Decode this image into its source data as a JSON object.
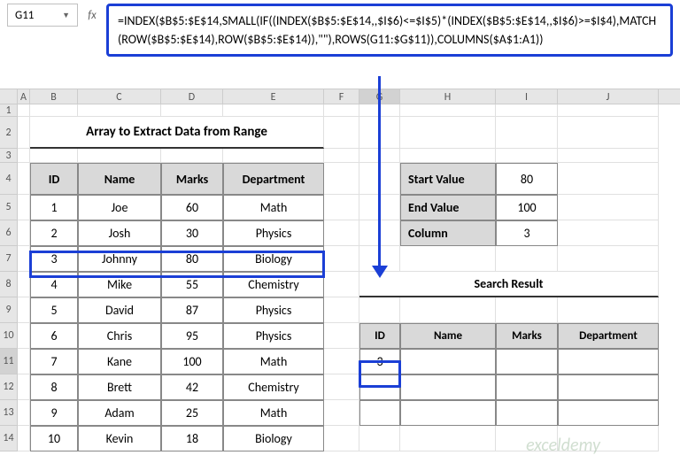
{
  "namebox": "G11",
  "formula": "=INDEX($B$5:$E$14,SMALL(IF((INDEX($B$5:$E$14,,$I$6)<=$I$5)*(INDEX($B$5:$E$14,,$I$6)>=$I$4),MATCH(ROW($B$5:$E$14),ROW($B$5:$E$14)),\"\"),ROWS(G11:$G$11)),COLUMNS($A$1:A1))",
  "cols": [
    "A",
    "B",
    "C",
    "D",
    "E",
    "F",
    "G",
    "H",
    "I",
    "J"
  ],
  "rows": [
    "1",
    "2",
    "3",
    "4",
    "5",
    "6",
    "7",
    "8",
    "9",
    "10",
    "11",
    "12",
    "13",
    "14"
  ],
  "title": "Array to Extract Data from Range",
  "headers": {
    "id": "ID",
    "name": "Name",
    "marks": "Marks",
    "dept": "Department"
  },
  "data": [
    {
      "id": "1",
      "name": "Joe",
      "marks": "60",
      "dept": "Math"
    },
    {
      "id": "2",
      "name": "Josh",
      "marks": "30",
      "dept": "Physics"
    },
    {
      "id": "3",
      "name": "Johnny",
      "marks": "80",
      "dept": "Biology"
    },
    {
      "id": "4",
      "name": "Mike",
      "marks": "55",
      "dept": "Chemistry"
    },
    {
      "id": "5",
      "name": "David",
      "marks": "87",
      "dept": "Physics"
    },
    {
      "id": "6",
      "name": "Chris",
      "marks": "95",
      "dept": "Physics"
    },
    {
      "id": "7",
      "name": "Kane",
      "marks": "100",
      "dept": "Math"
    },
    {
      "id": "8",
      "name": "Brett",
      "marks": "42",
      "dept": "Chemistry"
    },
    {
      "id": "9",
      "name": "Adam",
      "marks": "25",
      "dept": "Math"
    },
    {
      "id": "10",
      "name": "Kevin",
      "marks": "18",
      "dept": "Biology"
    }
  ],
  "params": {
    "start_label": "Start Value",
    "start_val": "80",
    "end_label": "End Value",
    "end_val": "100",
    "col_label": "Column",
    "col_val": "3"
  },
  "result_title": "Search Result",
  "result_headers": {
    "id": "ID",
    "name": "Name",
    "marks": "Marks",
    "dept": "Department"
  },
  "result_val": "3",
  "watermark": "exceldemy"
}
